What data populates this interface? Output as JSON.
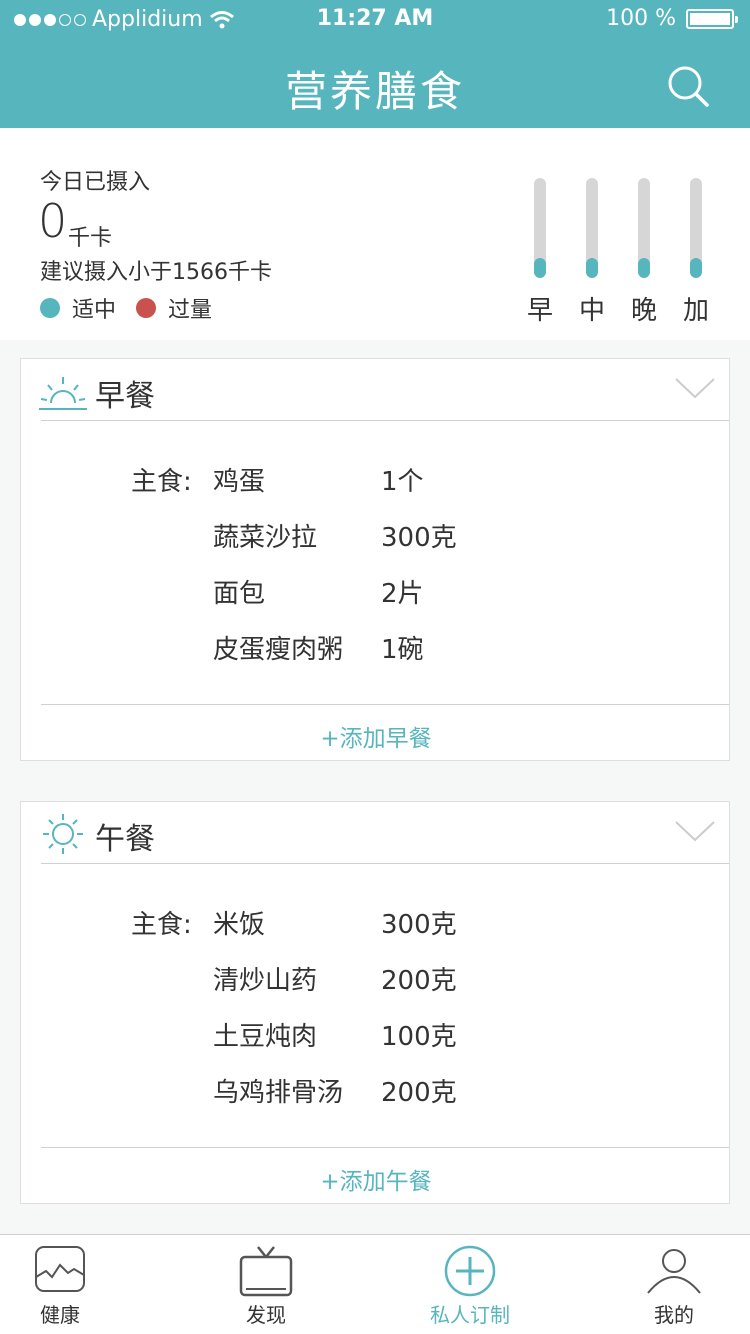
{
  "status_bar": {
    "carrier": "Applidium",
    "time": "11:27 AM",
    "battery": "100 %"
  },
  "header": {
    "title": "营养膳食"
  },
  "summary": {
    "label": "今日已摄入",
    "value": "0",
    "unit": "千卡",
    "advice": "建议摄入小于1566千卡",
    "legend": [
      {
        "label": "适中",
        "color": "#57b5be"
      },
      {
        "label": "过量",
        "color": "#c9524f"
      }
    ],
    "meal_bars": [
      {
        "label": "早",
        "fill": 0.2
      },
      {
        "label": "中",
        "fill": 0.2
      },
      {
        "label": "晚",
        "fill": 0.2
      },
      {
        "label": "加",
        "fill": 0.2
      }
    ]
  },
  "meals": [
    {
      "name": "早餐",
      "icon": "sunrise-icon",
      "category": "主食:",
      "items": [
        {
          "name": "鸡蛋",
          "amount": "1个"
        },
        {
          "name": "蔬菜沙拉",
          "amount": "300克"
        },
        {
          "name": "面包",
          "amount": "2片"
        },
        {
          "name": "皮蛋瘦肉粥",
          "amount": "1碗"
        }
      ],
      "add_label": "+添加早餐"
    },
    {
      "name": "午餐",
      "icon": "sun-icon",
      "category": "主食:",
      "items": [
        {
          "name": "米饭",
          "amount": "300克"
        },
        {
          "name": "清炒山药",
          "amount": "200克"
        },
        {
          "name": "土豆炖肉",
          "amount": "100克"
        },
        {
          "name": "乌鸡排骨汤",
          "amount": "200克"
        }
      ],
      "add_label": "+添加午餐"
    }
  ],
  "tabbar": {
    "tabs": [
      {
        "label": "健康",
        "icon": "health-chart-icon"
      },
      {
        "label": "发现",
        "icon": "tv-icon"
      },
      {
        "label": "私人订制",
        "icon": "plus-circle-icon",
        "active": true
      },
      {
        "label": "我的",
        "icon": "person-icon"
      }
    ]
  },
  "colors": {
    "accent": "#57b5be",
    "over": "#c9524f"
  }
}
